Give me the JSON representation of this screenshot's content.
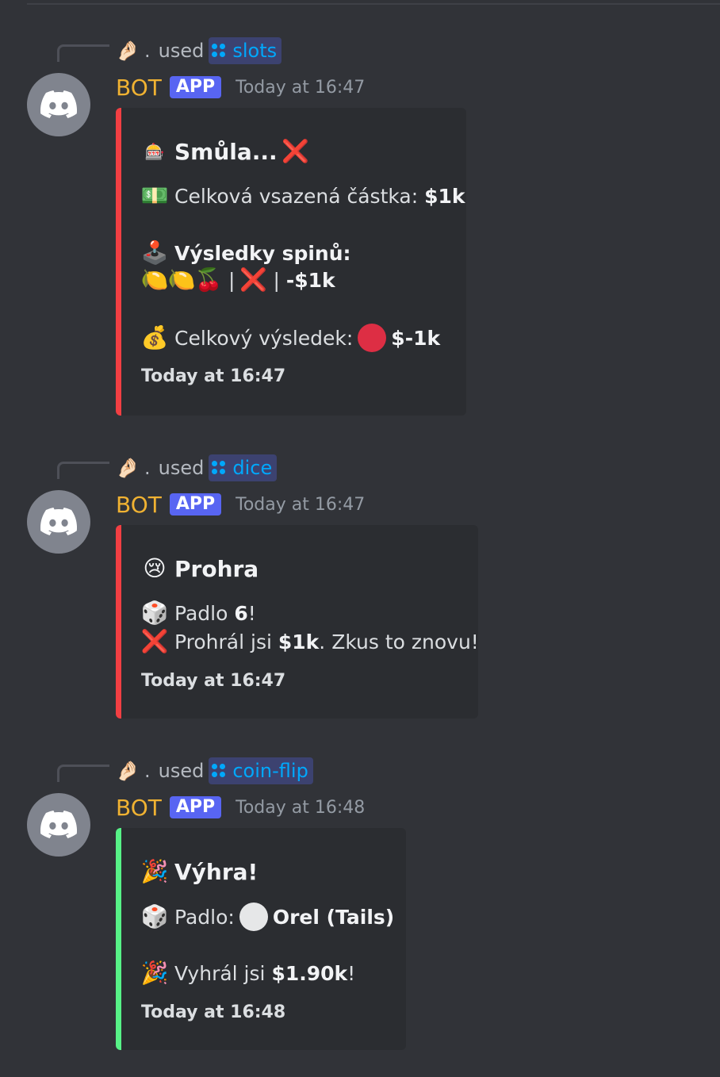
{
  "messages": [
    {
      "reply_user": ".",
      "reply_used": "used",
      "command": "slots",
      "author": "BOT",
      "tag": "APP",
      "timestamp": "Today at 16:47",
      "embed": {
        "title": "Smůla...",
        "bet_label": "Celková vsazená částka:",
        "bet_value": "$1k",
        "results_label": "Výsledky spinů:",
        "spin_sep1": "|",
        "spin_sep2": "|",
        "spin_value": "-$1k",
        "total_label": "Celkový výsledek:",
        "total_value": "$-1k",
        "footer": "Today at 16:47",
        "color": "#f23f43"
      }
    },
    {
      "reply_user": ".",
      "reply_used": "used",
      "command": "dice",
      "author": "BOT",
      "tag": "APP",
      "timestamp": "Today at 16:47",
      "embed": {
        "title": "Prohra",
        "rolled_label": "Padlo",
        "rolled_value": "6",
        "rolled_end": "!",
        "lost_label": "Prohrál jsi",
        "lost_value": "$1k",
        "lost_end": ". Zkus to znovu!",
        "footer": "Today at 16:47",
        "color": "#f23f43"
      }
    },
    {
      "reply_user": ".",
      "reply_used": "used",
      "command": "coin-flip",
      "author": "BOT",
      "tag": "APP",
      "timestamp": "Today at 16:48",
      "embed": {
        "title": "Výhra!",
        "rolled_label": "Padlo:",
        "rolled_value": "Orel (Tails)",
        "won_label": "Vyhrál jsi",
        "won_value": "$1.90k",
        "won_end": "!",
        "footer": "Today at 16:48",
        "color": "#57f287"
      }
    }
  ]
}
